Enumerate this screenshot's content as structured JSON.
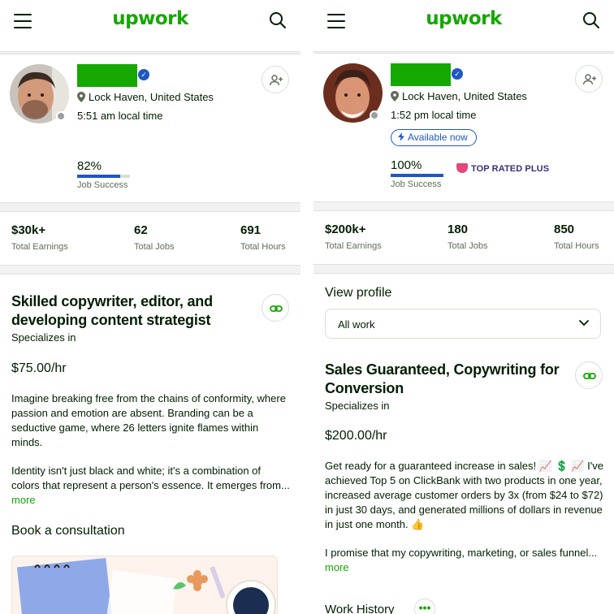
{
  "brand": {
    "logo": "upwork",
    "green": "#14a800",
    "blue": "#1f57c3"
  },
  "icons": {
    "menu": "hamburger-menu-icon",
    "search": "search-icon",
    "verified": "verified-badge-icon",
    "location": "location-pin-icon",
    "invite": "add-user-icon",
    "link": "link-icon",
    "bolt": "lightning-icon",
    "chevron": "chevron-down-icon",
    "more": "more-dots-icon"
  },
  "left": {
    "profile": {
      "location": "Lock Haven, United States",
      "local_time": "5:51 am local time",
      "job_success": "82%",
      "job_success_fraction": 0.82,
      "job_success_label": "Job Success"
    },
    "stats": [
      {
        "value": "$30k+",
        "label": "Total Earnings"
      },
      {
        "value": "62",
        "label": "Total Jobs"
      },
      {
        "value": "691",
        "label": "Total Hours"
      }
    ],
    "headline": "Skilled copywriter, editor, and developing content strategist",
    "specializes": "Specializes in",
    "rate": "$75.00/hr",
    "description_1": "Imagine breaking free from the chains of conformity, where passion and emotion are absent. Branding can be a seductive game, where 26 letters ignite flames within minds.",
    "description_2": "Identity isn't just black and white; it's a combination of colors that represent a person's essence. It emerges from...",
    "more": "more",
    "book_consultation": "Book a consultation"
  },
  "right": {
    "profile": {
      "location": "Lock Haven, United States",
      "local_time": "1:52 pm local time",
      "availability": "Available now",
      "job_success": "100%",
      "job_success_fraction": 1.0,
      "job_success_label": "Job Success",
      "badge": "TOP RATED PLUS"
    },
    "stats": [
      {
        "value": "$200k+",
        "label": "Total Earnings"
      },
      {
        "value": "180",
        "label": "Total Jobs"
      },
      {
        "value": "850",
        "label": "Total Hours"
      }
    ],
    "view_profile": "View profile",
    "select_value": "All work",
    "headline": "Sales Guaranteed, Copywriting for Conversion",
    "specializes": "Specializes in",
    "rate": "$200.00/hr",
    "description_1": "Get ready for a guaranteed increase in sales! 📈 💲 📈 I've achieved Top 5 on ClickBank with two products in one year, increased average customer orders by 3x (from $24 to $72) in just 30 days, and generated millions of dollars in revenue in just one month. 👍",
    "description_2": "I promise that my copywriting, marketing, or sales funnel...",
    "more": "more",
    "work_history": "Work History"
  }
}
